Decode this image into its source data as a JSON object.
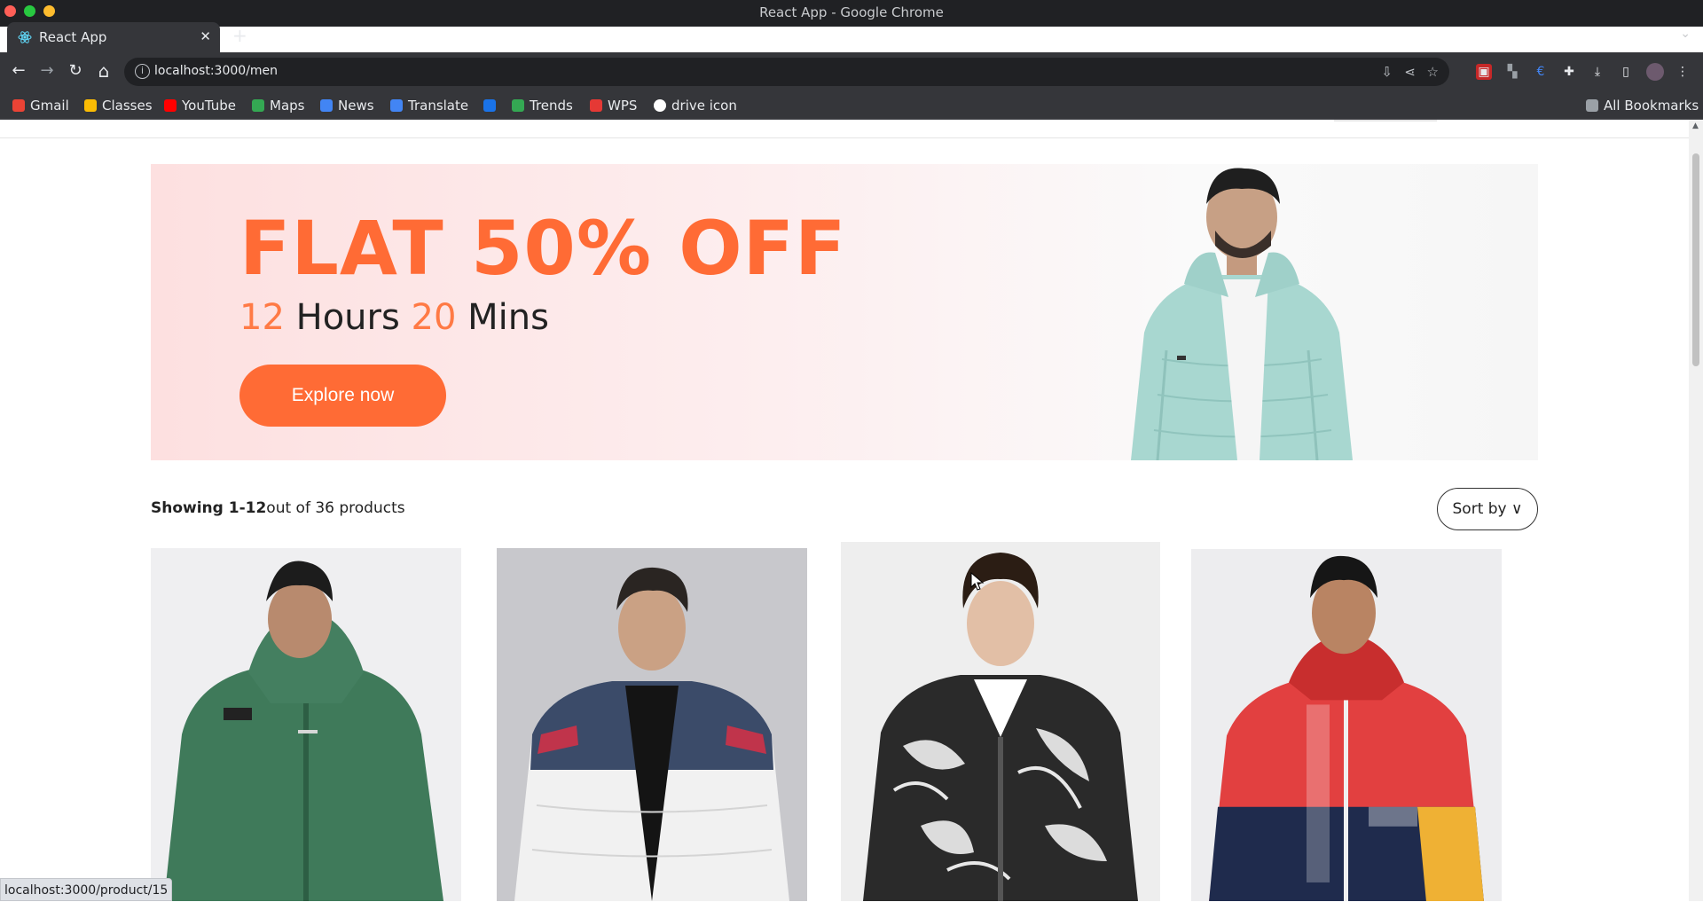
{
  "window": {
    "title": "React App - Google Chrome"
  },
  "tab": {
    "title": "React App",
    "close_glyph": "✕",
    "new_tab_glyph": "+"
  },
  "toolbar": {
    "url": "localhost:3000/men",
    "back_glyph": "←",
    "forward_glyph": "→",
    "reload_glyph": "↻",
    "home_glyph": "⌂",
    "info_glyph": "i"
  },
  "bookmarks": {
    "items": [
      {
        "label": "Gmail",
        "color": "#ea4335"
      },
      {
        "label": "Classes",
        "color": "#fbbc04"
      },
      {
        "label": "YouTube",
        "color": "#ff0000"
      },
      {
        "label": "Maps",
        "color": "#34a853"
      },
      {
        "label": "News",
        "color": "#4285f4"
      },
      {
        "label": "Translate",
        "color": "#4285f4"
      },
      {
        "label": "",
        "color": "#1a73e8"
      },
      {
        "label": "Trends",
        "color": "#34a853"
      },
      {
        "label": "WPS",
        "color": "#e53935"
      },
      {
        "label": "drive icon",
        "color": "#ffffff"
      }
    ],
    "all_bookmarks": "All Bookmarks"
  },
  "banner": {
    "headline": "FLAT 50% OFF",
    "hours_value": "12",
    "hours_label": "Hours",
    "mins_value": "20",
    "mins_label": "Mins",
    "cta": "Explore now",
    "accent_color": "#ff6b35"
  },
  "listing": {
    "count_strong": "Showing 1-12",
    "count_rest": "out of 36 products",
    "sort_label": "Sort by",
    "sort_chevron": "∨"
  },
  "products": [
    {
      "icon": "green-hoodie-image"
    },
    {
      "icon": "white-puffer-jacket-image"
    },
    {
      "icon": "marble-print-bomber-image"
    },
    {
      "icon": "red-colorblock-jacket-image"
    }
  ],
  "status_bar": {
    "url": "localhost:3000/product/15"
  }
}
